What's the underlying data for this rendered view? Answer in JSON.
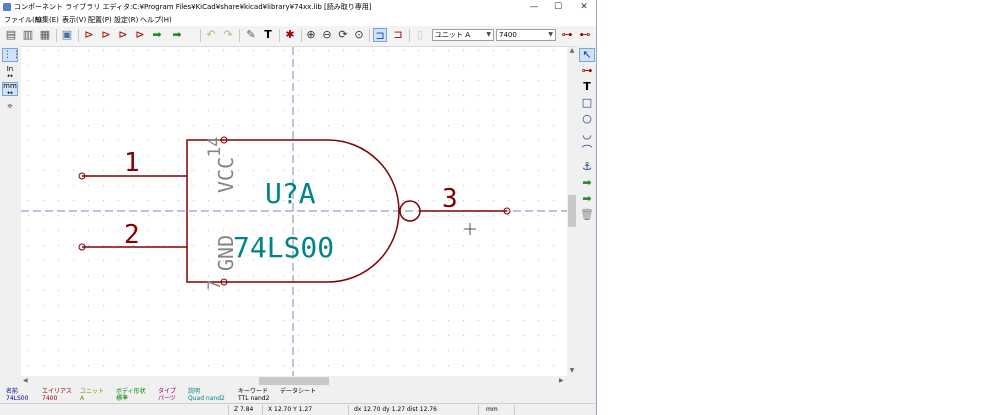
{
  "window": {
    "title": "コンポーネント ライブラリ エディタ:C:¥Program Files¥KiCad¥share¥kicad¥library¥74xx.lib [読み取り専用]",
    "minimize": "—",
    "maximize": "☐",
    "close": "✕"
  },
  "menu": [
    {
      "label": "ファイル(F)"
    },
    {
      "label": "編集(E)"
    },
    {
      "label": "表示(V)"
    },
    {
      "label": "配置(P)"
    },
    {
      "label": "設定(R)"
    },
    {
      "label": "ヘルプ(H)"
    }
  ],
  "toolbar": {
    "unit_select": "ユニット A",
    "alias_select": "7400"
  },
  "left_toolbar": {
    "inch_label": "In",
    "mm_label": "mm"
  },
  "symbol": {
    "reference": "U?A",
    "value": "74LS00",
    "pins": [
      {
        "number": "1"
      },
      {
        "number": "2"
      },
      {
        "number": "3"
      },
      {
        "name": "VCC",
        "number": "14"
      },
      {
        "name": "GND",
        "number": "7"
      }
    ],
    "colors": {
      "body": "#840000",
      "fields": "#008484",
      "pin_names": "#848484",
      "grid": "#c0c0c0",
      "axis": "#8080c0"
    }
  },
  "message_panel": {
    "fields": [
      {
        "label": "名前",
        "value": "74LS00",
        "color": "#000084"
      },
      {
        "label": "エイリアス",
        "value": "7400",
        "color": "#840000"
      },
      {
        "label": "ユニット",
        "value": "A",
        "color": "#848400"
      },
      {
        "label": "ボディ形状",
        "value": "標準",
        "color": "#008400"
      },
      {
        "label": "タイプ",
        "value": "パーツ",
        "color": "#840084"
      },
      {
        "label": "説明",
        "value": "Quad nand2",
        "color": "#008484"
      },
      {
        "label": "キーワード",
        "value": "TTL nand2",
        "color": "#000000"
      },
      {
        "label": "データシート",
        "value": "",
        "color": "#000000"
      }
    ]
  },
  "status": {
    "zoom": "Z 7.84",
    "xy": "X 12.70  Y 1.27",
    "delta": "dx 12.70  dy 1.27  dist 12.76",
    "units": "mm"
  }
}
